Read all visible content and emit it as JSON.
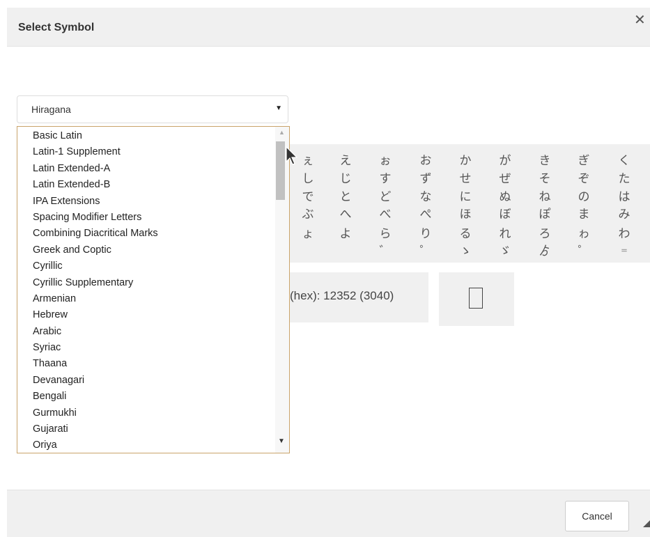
{
  "dialog": {
    "title": "Select Symbol",
    "close_icon": "close-icon",
    "cancel_label": "Cancel"
  },
  "block_select": {
    "selected": "Hiragana",
    "options": [
      "Basic Latin",
      "Latin-1 Supplement",
      "Latin Extended-A",
      "Latin Extended-B",
      "IPA Extensions",
      "Spacing Modifier Letters",
      "Combining Diacritical Marks",
      "Greek and Coptic",
      "Cyrillic",
      "Cyrillic Supplementary",
      "Armenian",
      "Hebrew",
      "Arabic",
      "Syriac",
      "Thaana",
      "Devanagari",
      "Bengali",
      "Gurmukhi",
      "Gujarati",
      "Oriya"
    ]
  },
  "symbol_grid": {
    "rows": [
      [
        "ぇ",
        "え",
        "ぉ",
        "お",
        "か",
        "が",
        "き",
        "ぎ",
        "く"
      ],
      [
        "し",
        "じ",
        "す",
        "ず",
        "せ",
        "ぜ",
        "そ",
        "ぞ",
        "た"
      ],
      [
        "で",
        "と",
        "ど",
        "な",
        "に",
        "ぬ",
        "ね",
        "の",
        "は"
      ],
      [
        "ぶ",
        "へ",
        "べ",
        "ぺ",
        "ほ",
        "ぼ",
        "ぽ",
        "ま",
        "み"
      ],
      [
        "ょ",
        "よ",
        "ら",
        "り",
        "る",
        "れ",
        "ろ",
        "ゎ",
        "わ"
      ],
      [
        "",
        "",
        "゛",
        "゜",
        "ゝ",
        "ゞ",
        "ゟ",
        "゜",
        "゠"
      ]
    ]
  },
  "info": {
    "code_text": "(hex): 12352 (3040)"
  },
  "colors": {
    "header_bg": "#f0f0f0",
    "listbox_border": "#c9a36a"
  }
}
